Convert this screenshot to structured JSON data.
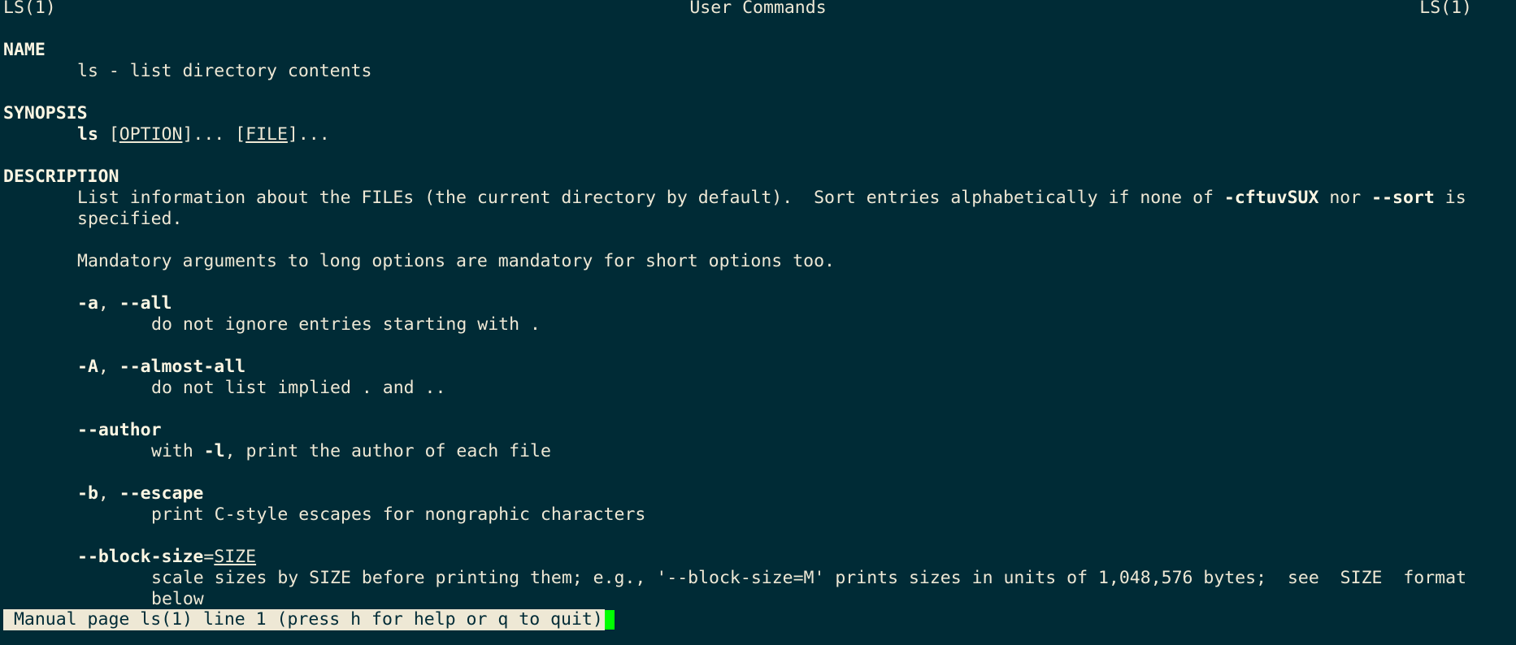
{
  "header": {
    "left": "LS(1)",
    "center": "User Commands",
    "right": "LS(1)"
  },
  "name_section": {
    "heading": "NAME",
    "text": "ls - list directory contents"
  },
  "synopsis_section": {
    "heading": "SYNOPSIS",
    "cmd": "ls",
    "open1": " [",
    "option": "OPTION",
    "mid": "]... [",
    "file": "FILE",
    "close": "]..."
  },
  "description_section": {
    "heading": "DESCRIPTION",
    "para1_a": "List information about the FILEs (the current directory by default).  Sort entries alphabetically if none of ",
    "para1_b": "-cftuvSUX",
    "para1_c": " nor ",
    "para1_d": "--sort",
    "para1_e": " is",
    "para1_line2": "specified.",
    "para2": "Mandatory arguments to long options are mandatory for short options too."
  },
  "options": [
    {
      "short": "-a",
      "sep": ", ",
      "long": "--all",
      "desc": "do not ignore entries starting with ."
    },
    {
      "short": "-A",
      "sep": ", ",
      "long": "--almost-all",
      "desc": "do not list implied . and .."
    },
    {
      "long": "--author",
      "desc_a": "with ",
      "desc_b": "-l",
      "desc_c": ", print the author of each file"
    },
    {
      "short": "-b",
      "sep": ", ",
      "long": "--escape",
      "desc": "print C-style escapes for nongraphic characters"
    },
    {
      "long": "--block-size",
      "eq": "=",
      "arg": "SIZE",
      "desc_line1": "scale sizes by SIZE before printing them; e.g., '--block-size=M' prints sizes in units of 1,048,576 bytes;  see  SIZE  format",
      "desc_line2": "below"
    }
  ],
  "status_bar": {
    "text": " Manual page ls(1) line 1 (press h for help or q to quit)"
  },
  "colors": {
    "background": "#002b36",
    "foreground": "#eee8d5",
    "cursor": "#00ff00"
  }
}
